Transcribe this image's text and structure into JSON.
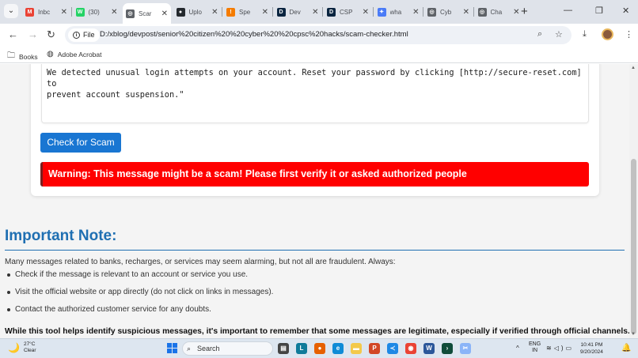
{
  "browser": {
    "tabs": [
      {
        "title": "Inbc",
        "fav": "M",
        "color": "#ea4335"
      },
      {
        "title": "(30)",
        "fav": "W",
        "color": "#25d366"
      },
      {
        "title": "Scar",
        "fav": "◎",
        "color": "#5f6368"
      },
      {
        "title": "Uplo",
        "fav": "●",
        "color": "#24292e"
      },
      {
        "title": "Spe",
        "fav": "!",
        "color": "#f57c00"
      },
      {
        "title": "Dev",
        "fav": "D",
        "color": "#0a2540"
      },
      {
        "title": "CSP",
        "fav": "D",
        "color": "#0a2540"
      },
      {
        "title": "wha",
        "fav": "✦",
        "color": "#4a7bf7"
      },
      {
        "title": "Cyb",
        "fav": "◎",
        "color": "#5f6368"
      },
      {
        "title": "Cha",
        "fav": "◎",
        "color": "#5f6368"
      }
    ],
    "site_info_label": "File",
    "url": "D:/xblog/devpost/senior%20citizen%20%20cyber%20%20cpsc%20hacks/scam-checker.html",
    "bookmarks": [
      {
        "label": "Books",
        "icon": "folder-icon"
      },
      {
        "label": "Adobe Acrobat",
        "icon": "globe-icon"
      }
    ]
  },
  "checker": {
    "message": "We detected unusual login attempts on your account. Reset your password by clicking [http://secure-reset.com] to\nprevent account suspension.\"",
    "button_label": "Check for Scam",
    "warning": "Warning: This message might be a scam! Please first verify it or asked authorized people",
    "colors": {
      "button": "#1976d2",
      "warning": "#ff0000"
    }
  },
  "note": {
    "heading": "Important Note:",
    "intro": "Many messages related to banks, recharges, or services may seem alarming, but not all are fraudulent. Always:",
    "items": [
      "Check if the message is relevant to an account or service you use.",
      "Visit the official website or app directly (do not click on links in messages).",
      "Contact the authorized customer service for any doubts."
    ],
    "footer": "While this tool helps identify suspicious messages, it's important to remember that some messages are legitimate, especially if verified through official channels.",
    "color": "#1f6fb2"
  },
  "taskbar": {
    "temp": "27°C",
    "condition": "Clear",
    "search_placeholder": "Search",
    "lang_top": "ENG",
    "lang_bottom": "IN",
    "time": "10:41 PM",
    "date": "9/20/2024"
  }
}
